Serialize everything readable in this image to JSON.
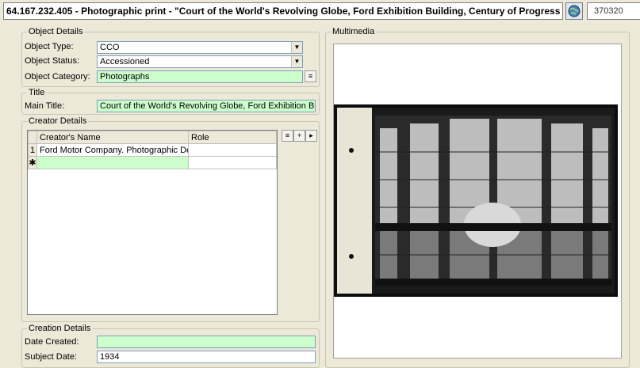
{
  "window": {
    "title": "64.167.232.405 - Photographic print - \"Court of the World's Revolving Globe, Ford Exhibition Building, Century of Progress International",
    "record_id": "370320"
  },
  "object_details": {
    "legend": "Object Details",
    "type_label": "Object Type:",
    "type_value": "CCO",
    "status_label": "Object Status:",
    "status_value": "Accessioned",
    "category_label": "Object Category:",
    "category_value": "Photographs"
  },
  "title_section": {
    "legend": "Title",
    "main_title_label": "Main Title:",
    "main_title_value": "Court of the World's Revolving Globe, Ford Exhibition Building, C"
  },
  "creator_details": {
    "legend": "Creator Details",
    "columns": [
      "Creator's Name",
      "Role"
    ],
    "rows": [
      {
        "index": "1",
        "name": "Ford Motor Company. Photographic Depart...",
        "role": ""
      }
    ],
    "new_row_marker": "✱"
  },
  "creation_details": {
    "legend": "Creation Details",
    "date_created_label": "Date Created:",
    "date_created_value": "",
    "subject_date_label": "Subject Date:",
    "subject_date_value": "1934"
  },
  "multimedia": {
    "legend": "Multimedia"
  },
  "colors": {
    "required_field": "#ccffcc",
    "window_bg": "#ece9d8"
  }
}
